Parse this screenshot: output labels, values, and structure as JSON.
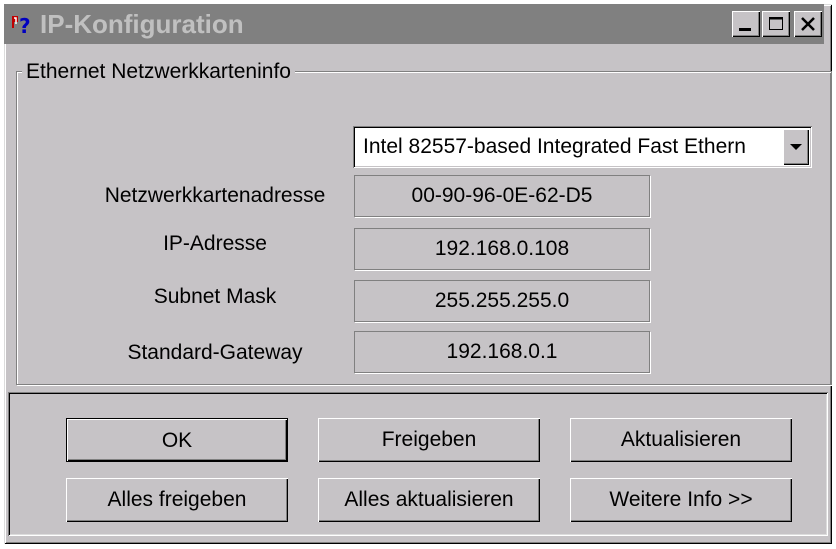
{
  "window": {
    "title": "IP-Konfiguration",
    "controls": [
      "minimize",
      "maximize",
      "close"
    ],
    "icon": "network-help-icon"
  },
  "group": {
    "title": "Ethernet  Netzwerkkarteninfo"
  },
  "adapter_select": {
    "selected": "Intel 82557-based Integrated Fast Ethern"
  },
  "fields": {
    "mac": {
      "label": "Netzwerkkartenadresse",
      "value": "00-90-96-0E-62-D5"
    },
    "ip": {
      "label": "IP-Adresse",
      "value": "192.168.0.108"
    },
    "subnet": {
      "label": "Subnet Mask",
      "value": "255.255.255.0"
    },
    "gateway": {
      "label": "Standard-Gateway",
      "value": "192.168.0.1"
    }
  },
  "buttons": {
    "ok": "OK",
    "release": "Freigeben",
    "renew": "Aktualisieren",
    "release_all": "Alles freigeben",
    "renew_all": "Alles aktualisieren",
    "more_info": "Weitere Info >>"
  },
  "colors": {
    "face": "#c6c3c6",
    "titlebar_inactive": "#808080",
    "title_text": "#c0c0c0"
  }
}
